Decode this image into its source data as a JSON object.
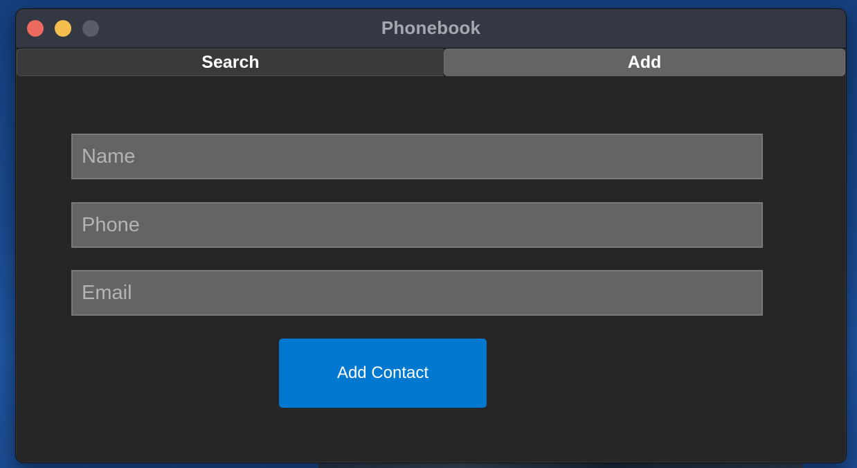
{
  "window": {
    "title": "Phonebook"
  },
  "tabs": [
    {
      "label": "Search",
      "selected": false
    },
    {
      "label": "Add",
      "selected": true
    }
  ],
  "form": {
    "name": {
      "value": "",
      "placeholder": "Name"
    },
    "phone": {
      "value": "",
      "placeholder": "Phone"
    },
    "email": {
      "value": "",
      "placeholder": "Email"
    },
    "submit_label": "Add Contact"
  },
  "colors": {
    "accent": "#0078cf",
    "window_bg": "#262626",
    "titlebar_bg": "#333842",
    "field_bg": "#646464",
    "close": "#ec6a5e",
    "minimize": "#f4bf4f",
    "zoom_inactive": "#585d68"
  }
}
